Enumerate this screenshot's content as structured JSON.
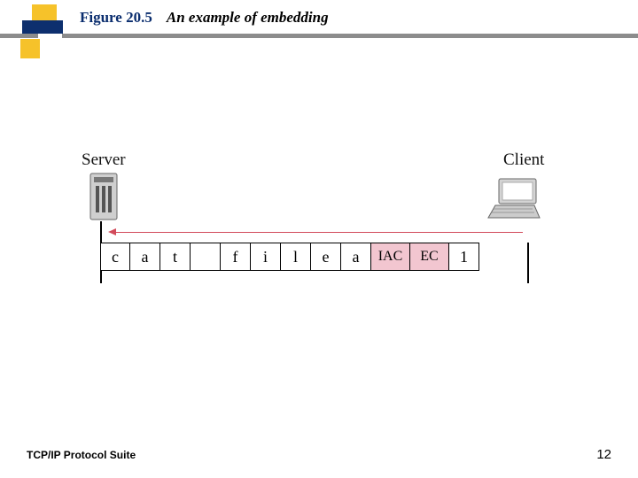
{
  "title": {
    "figure_label": "Figure 20.5",
    "caption": "An example of embedding"
  },
  "diagram": {
    "server_label": "Server",
    "client_label": "Client",
    "cells": [
      "c",
      "a",
      "t",
      " ",
      "f",
      "i",
      "l",
      "e",
      "a",
      "IAC",
      "EC",
      "1"
    ]
  },
  "footer": {
    "left": "TCP/IP Protocol Suite",
    "page": "12"
  },
  "icons": {
    "server": "server-icon",
    "laptop": "laptop-icon"
  },
  "colors": {
    "title_blue": "#0a2d6e",
    "arrow": "#d24a5a",
    "highlight": "#F2C6D0",
    "deco_navy": "#0d2f6e",
    "deco_yellow": "#f6c22a"
  }
}
